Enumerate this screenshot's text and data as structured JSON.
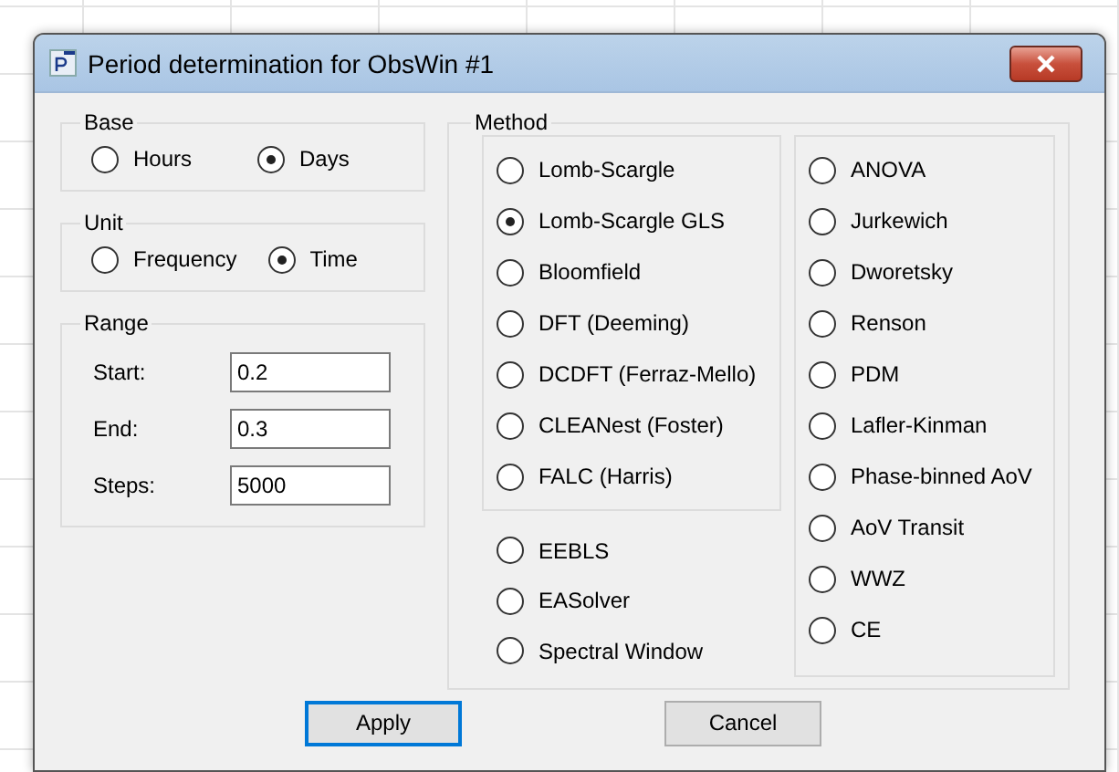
{
  "window": {
    "title": "Period determination for ObsWin #1"
  },
  "base": {
    "label": "Base",
    "options": [
      {
        "label": "Hours",
        "selected": false
      },
      {
        "label": "Days",
        "selected": true
      }
    ]
  },
  "unit": {
    "label": "Unit",
    "options": [
      {
        "label": "Frequency",
        "selected": false
      },
      {
        "label": "Time",
        "selected": true
      }
    ]
  },
  "range": {
    "label": "Range",
    "fields": [
      {
        "label": "Start:",
        "value": "0.2"
      },
      {
        "label": "End:",
        "value": "0.3"
      },
      {
        "label": "Steps:",
        "value": "5000"
      }
    ]
  },
  "method": {
    "label": "Method",
    "framed_left": [
      {
        "label": "Lomb-Scargle",
        "selected": false
      },
      {
        "label": "Lomb-Scargle GLS",
        "selected": true
      },
      {
        "label": "Bloomfield",
        "selected": false
      },
      {
        "label": "DFT (Deeming)",
        "selected": false
      },
      {
        "label": "DCDFT (Ferraz-Mello)",
        "selected": false
      },
      {
        "label": "CLEANest (Foster)",
        "selected": false
      },
      {
        "label": "FALC (Harris)",
        "selected": false
      }
    ],
    "loose_left": [
      {
        "label": "EEBLS",
        "selected": false
      },
      {
        "label": "EASolver",
        "selected": false
      },
      {
        "label": "Spectral Window",
        "selected": false
      }
    ],
    "framed_right": [
      {
        "label": "ANOVA",
        "selected": false
      },
      {
        "label": "Jurkewich",
        "selected": false
      },
      {
        "label": "Dworetsky",
        "selected": false
      },
      {
        "label": "Renson",
        "selected": false
      },
      {
        "label": "PDM",
        "selected": false
      },
      {
        "label": "Lafler-Kinman",
        "selected": false
      },
      {
        "label": "Phase-binned AoV",
        "selected": false
      },
      {
        "label": "AoV Transit",
        "selected": false
      },
      {
        "label": "WWZ",
        "selected": false
      },
      {
        "label": "CE",
        "selected": false
      }
    ]
  },
  "buttons": [
    {
      "label": "Apply",
      "focused": true
    },
    {
      "label": "Cancel",
      "focused": false
    }
  ]
}
